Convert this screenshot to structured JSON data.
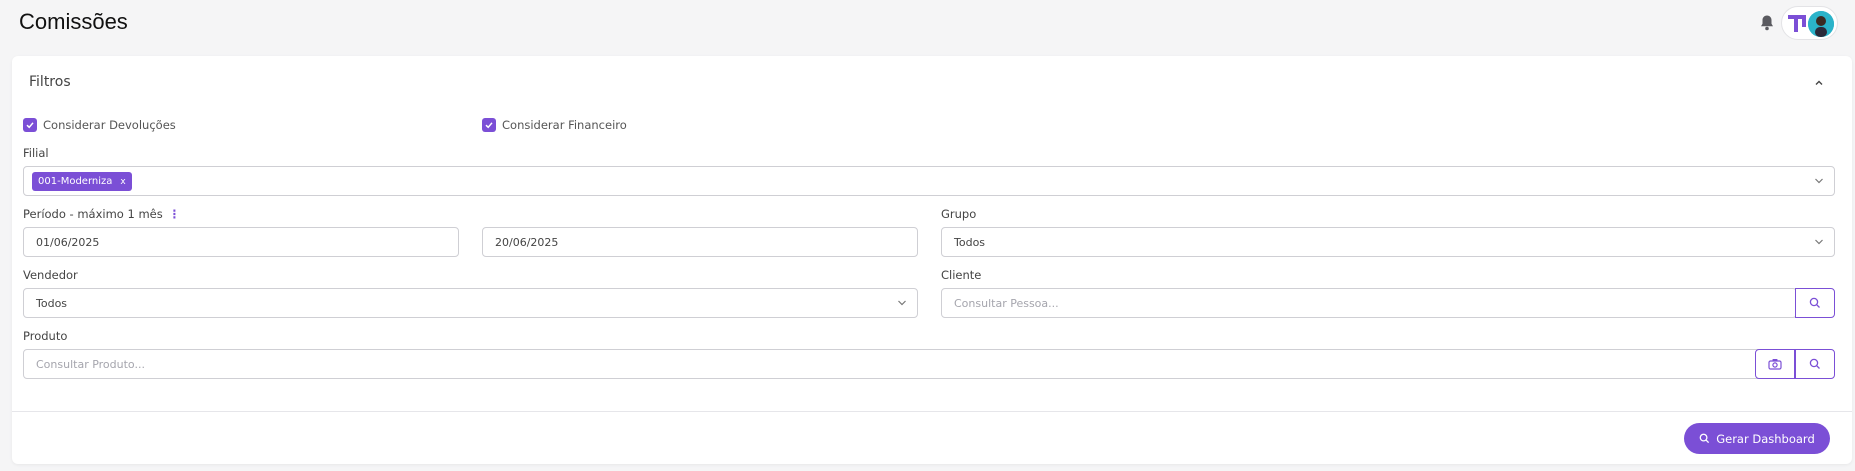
{
  "header": {
    "title": "Comissões",
    "notification_icon": "bell-icon",
    "logo_icon": "brand-logo-icon",
    "avatar_icon": "user-avatar"
  },
  "filters": {
    "title": "Filtros",
    "collapse_icon": "chevron-up-icon",
    "checkboxes": [
      {
        "label": "Considerar Devoluções",
        "checked": true
      },
      {
        "label": "Considerar Financeiro",
        "checked": true
      }
    ],
    "filial": {
      "label": "Filial",
      "chips": [
        {
          "label": "001-Moderniza",
          "remove": "x"
        }
      ]
    },
    "periodo": {
      "label": "Período - máximo 1 mês",
      "start": "01/06/2025",
      "end": "20/06/2025"
    },
    "grupo": {
      "label": "Grupo",
      "value": "Todos"
    },
    "vendedor": {
      "label": "Vendedor",
      "value": "Todos"
    },
    "cliente": {
      "label": "Cliente",
      "placeholder": "Consultar Pessoa..."
    },
    "produto": {
      "label": "Produto",
      "placeholder": "Consultar Produto..."
    }
  },
  "actions": {
    "generate_label": "Gerar Dashboard"
  },
  "colors": {
    "accent": "#7b4fd6",
    "border": "#cfcfd4",
    "background": "#f5f5f6"
  }
}
